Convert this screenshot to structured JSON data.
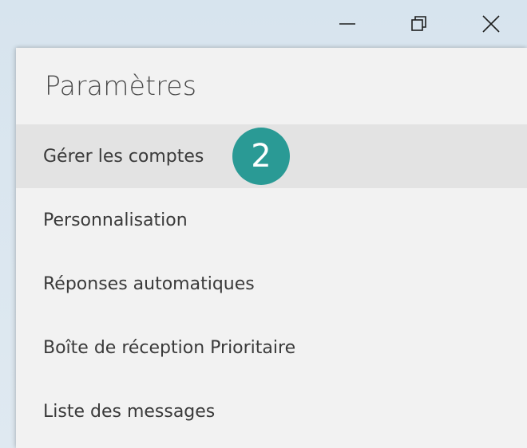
{
  "window": {
    "minimize_icon": "minimize-icon",
    "restore_icon": "restore-icon",
    "close_icon": "close-icon"
  },
  "settings": {
    "title": "Paramètres",
    "items": [
      {
        "label": "Gérer les comptes",
        "selected": true
      },
      {
        "label": "Personnalisation",
        "selected": false
      },
      {
        "label": "Réponses automatiques",
        "selected": false
      },
      {
        "label": "Boîte de réception Prioritaire",
        "selected": false
      },
      {
        "label": "Liste des messages",
        "selected": false
      }
    ]
  },
  "annotation": {
    "step_number": "2",
    "color": "#2a9a95"
  }
}
